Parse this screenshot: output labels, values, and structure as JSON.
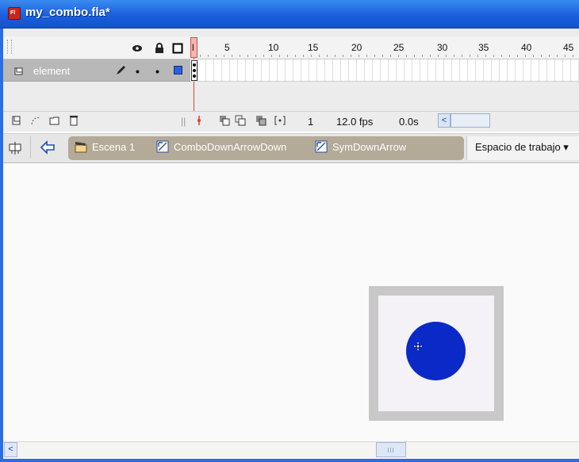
{
  "window": {
    "title": "my_combo.fla*",
    "app_icon_text": "Fl"
  },
  "timeline": {
    "frame_numbers": [
      "5",
      "10",
      "15",
      "20",
      "25",
      "30",
      "35",
      "40",
      "45"
    ],
    "current_frame_marker": "l",
    "header_icons": [
      "eye-icon",
      "lock-icon",
      "outline-square-icon"
    ],
    "layer": {
      "name": "element",
      "icons": [
        "layer-icon",
        "pencil-icon",
        "dot-icon",
        "dot-icon",
        "blue-square-icon"
      ]
    },
    "footer": {
      "current_frame": "1",
      "fps": "12.0 fps",
      "elapsed": "0.0s"
    }
  },
  "editbar": {
    "crumbs": [
      {
        "label": "Escena 1",
        "icon": "scene-icon"
      },
      {
        "label": "ComboDownArrowDown",
        "icon": "movieclip-symbol-icon"
      },
      {
        "label": "SymDownArrow",
        "icon": "movieclip-symbol-icon"
      }
    ],
    "workspace_label": "Espacio de trabajo ▾"
  },
  "stage": {
    "symbol_frame_color": "#c8c8c8",
    "symbol_bg_color": "#f4f2f6",
    "circle_color": "#0b29c7"
  },
  "colors": {
    "titlebar": "#1a5fdc",
    "layer_row": "#b8b8b8",
    "breadcrumb_bg": "#b3aa98"
  }
}
